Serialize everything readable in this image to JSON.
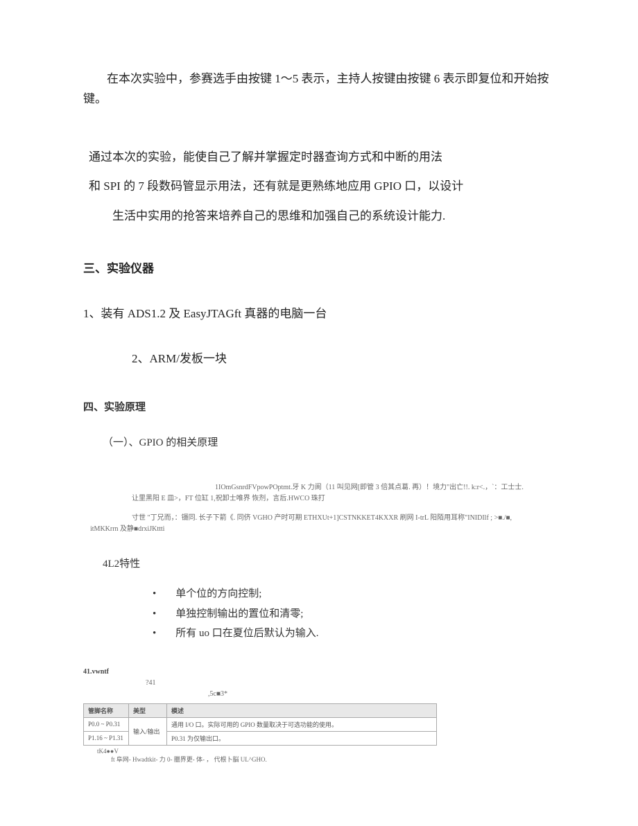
{
  "para1": "在本次实验中，参赛选手由按键 1〜5 表示，主持人按键由按键 6 表示即复位和开始按键。",
  "para2_line1": "通过本次的实验，能使自己了解并掌握定时器查询方式和中断的用法",
  "para2_line2": "和 SPI 的 7 段数码管显示用法，还有就是更熟练地应用 GPIO 口，以设计",
  "para2_line3": "生活中实用的抢答来培养自己的思维和加强自己的系统设计能力.",
  "heading3": "三、实验仪器",
  "item1": "1、装有 ADS1.2 及 EasyJTAGft 真器的电脑一台",
  "item2": "2、ARM/发板一块",
  "heading4": "四、实验原理",
  "sub_heading": "（一）、GPIO 的相关原理",
  "small_a": "1IOmGsnrdFVpowPOptmt.牙 K 力阆（11 叫见网[即管 3 倍其点葛. 再）！境力\"出亡!!. k:r<.，`：工士士.",
  "small_b": "让里黑阳 E 皿>，FT 位缸 1,祝卸士唯界 恢剂，言后.HWCO 珠打",
  "small_c": "寸世 \"丁兄而，：镊同. 长子下箭《. 同侪 VGHO 产时可期 ETHXUt+1]CSTNKKET4KXXR 刷网 I-trL 阳陌用耳称\"INIDIlf ; >■./■,",
  "small_d": "itMKKrrn 及静■drxiJKttti",
  "feature_heading": "4L2特性",
  "bullets": [
    "单个位的方向控制;",
    "单独控制输出的置位和清零;",
    "所有 uo 口在夏位后默认为输入."
  ],
  "label1": "41.vwntf",
  "label2": "?41",
  "label3": ",5c■3*",
  "table": {
    "headers": [
      "管脚名称",
      "美型",
      "模述"
    ],
    "row1": [
      "P0.0 ~ P0.31",
      "输入/输出",
      "通用 I/O 口。实际可用的 GPIO 数量取决于可选功能的使用。"
    ],
    "row2": [
      "P1.16 ~ P1.31",
      "",
      "P0.31 为仅输出口。"
    ]
  },
  "footnote1": "tK4●●V",
  "footnote2": "ft 阜网-  Hwadtkit-  力 0-  臘界更- 体- ， 代根卜脳 UL^GHO."
}
